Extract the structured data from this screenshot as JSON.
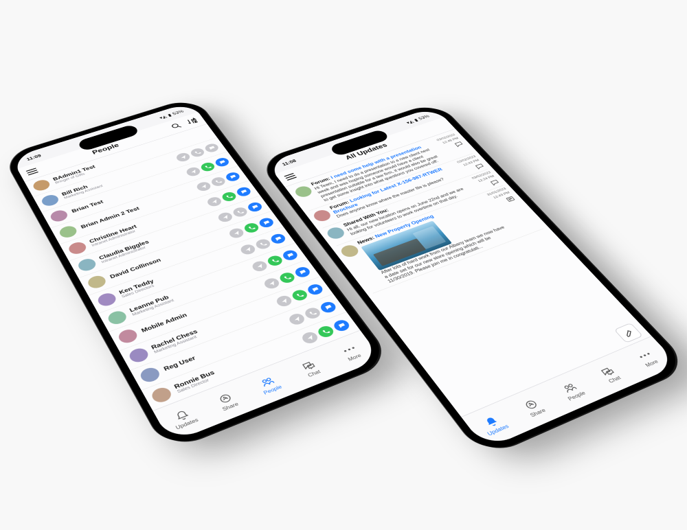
{
  "status_time": "11:09",
  "status_time2": "11:08",
  "status_batt": "53%",
  "phone1": {
    "title": "People",
    "people": [
      {
        "name": "BAdmin1 Test",
        "role": "Bringer of Gifts",
        "call": "none",
        "chat": "none"
      },
      {
        "name": "Bill Rich",
        "role": "Marketing Assistant",
        "call": "grey",
        "chat": "grey"
      },
      {
        "name": "Brian Test",
        "role": "",
        "call": "green",
        "chat": "blue"
      },
      {
        "name": "Brian Admin 2 Test",
        "role": "",
        "call": "grey",
        "chat": "blue"
      },
      {
        "name": "Christine Heart",
        "role": "Intranet Administrator",
        "call": "green",
        "chat": "blue"
      },
      {
        "name": "Claudia Biggles",
        "role": "Intranet Administrator",
        "call": "grey",
        "chat": "blue"
      },
      {
        "name": "David Collinson",
        "role": "",
        "call": "green",
        "chat": "blue"
      },
      {
        "name": "Ken Teddy",
        "role": "Sales Directors",
        "call": "grey",
        "chat": "blue"
      },
      {
        "name": "Leanne Pub",
        "role": "Marketing Assistant",
        "call": "green",
        "chat": "blue"
      },
      {
        "name": "Mobile Admin",
        "role": "",
        "call": "green",
        "chat": "blue"
      },
      {
        "name": "Rachel Chess",
        "role": "Marketing Assistant",
        "call": "green",
        "chat": "blue"
      },
      {
        "name": "Reg User",
        "role": "",
        "call": "grey",
        "chat": "blue"
      },
      {
        "name": "Ronnie Bus",
        "role": "Sales Director",
        "call": "green",
        "chat": "blue"
      }
    ]
  },
  "phone2": {
    "title": "All Updates",
    "feed": [
      {
        "kind": "Forum:",
        "link": "I need some help with a presentation",
        "text": "Hi Team, I need to do a presentation to a new client next week and was hoping someone would have a client presentation suitable for a law firm, it would also be great to get some insight into what questions you covered off:",
        "date": "03/02/2023",
        "time": "12:46 PM",
        "icon": "chat"
      },
      {
        "kind": "Forum:",
        "link": "Looking for Latest X-156-987-RTWER Brochure",
        "text": "Does anyone know where the master file is please?",
        "date": "03/02/2023",
        "time": "12:43 PM",
        "icon": "chat"
      },
      {
        "kind": "Shared With You:",
        "link": "",
        "text": "Hi all, our new location opens on June 22nd and we are looking for volunteers to work overtime on that day.",
        "date": "03/02/2023",
        "time": "12:24 PM",
        "icon": "chat"
      },
      {
        "kind": "News:",
        "link": "New Property Opening",
        "text": "After lots of hard work from our Albany team we now have a date set for our new store opening which will be 11/30/2019. Please join me in congratulati...",
        "date": "31/01/2023",
        "time": "12:43 PM",
        "icon": "news",
        "thumb": true
      }
    ]
  },
  "tabs": [
    "Updates",
    "Share",
    "People",
    "Chat",
    "More"
  ]
}
